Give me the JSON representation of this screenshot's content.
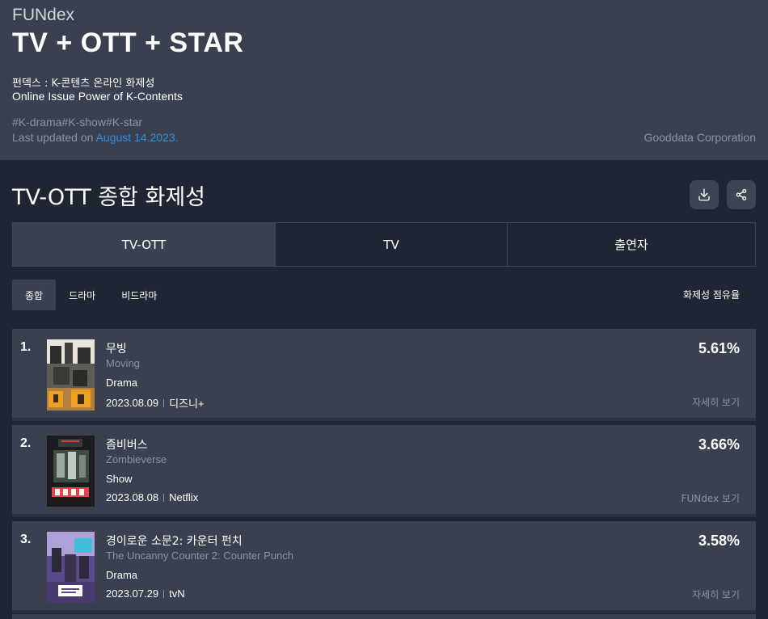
{
  "header": {
    "brand": "FUNdex",
    "title": "TV + OTT + STAR",
    "desc_ko": "펀덱스 : K-콘텐츠 온라인 화제성",
    "desc_en": "Online Issue Power of K-Contents",
    "tags": "#K-drama#K-show#K-star",
    "updated_prefix": "Last updated on ",
    "updated_date": "August 14.2023.",
    "corp": "Gooddata Corporation"
  },
  "section": {
    "title": "TV-OTT 종합 화제성",
    "download_icon": "download-icon",
    "share_icon": "share-icon"
  },
  "tabs": [
    {
      "label": "TV-OTT",
      "active": true
    },
    {
      "label": "TV",
      "active": false
    },
    {
      "label": "출연자",
      "active": false
    }
  ],
  "subtabs": [
    {
      "label": "종합",
      "active": true
    },
    {
      "label": "드라마",
      "active": false
    },
    {
      "label": "비드라마",
      "active": false
    }
  ],
  "share_label": "화제성 점유율",
  "rankings": [
    {
      "rank": "1.",
      "title_ko": "무빙",
      "title_en": "Moving",
      "genre": "Drama",
      "date": "2023.08.09",
      "channel": "디즈니+",
      "percent": "5.61%",
      "link": "자세히 보기"
    },
    {
      "rank": "2.",
      "title_ko": "좀비버스",
      "title_en": "Zombieverse",
      "genre": "Show",
      "date": "2023.08.08",
      "channel": "Netflix",
      "percent": "3.66%",
      "link": "FUNdex 보기"
    },
    {
      "rank": "3.",
      "title_ko": "경이로운 소문2: 카운터 펀치",
      "title_en": "The Uncanny Counter 2: Counter Punch",
      "genre": "Drama",
      "date": "2023.07.29",
      "channel": "tvN",
      "percent": "3.58%",
      "link": "자세히 보기"
    }
  ]
}
